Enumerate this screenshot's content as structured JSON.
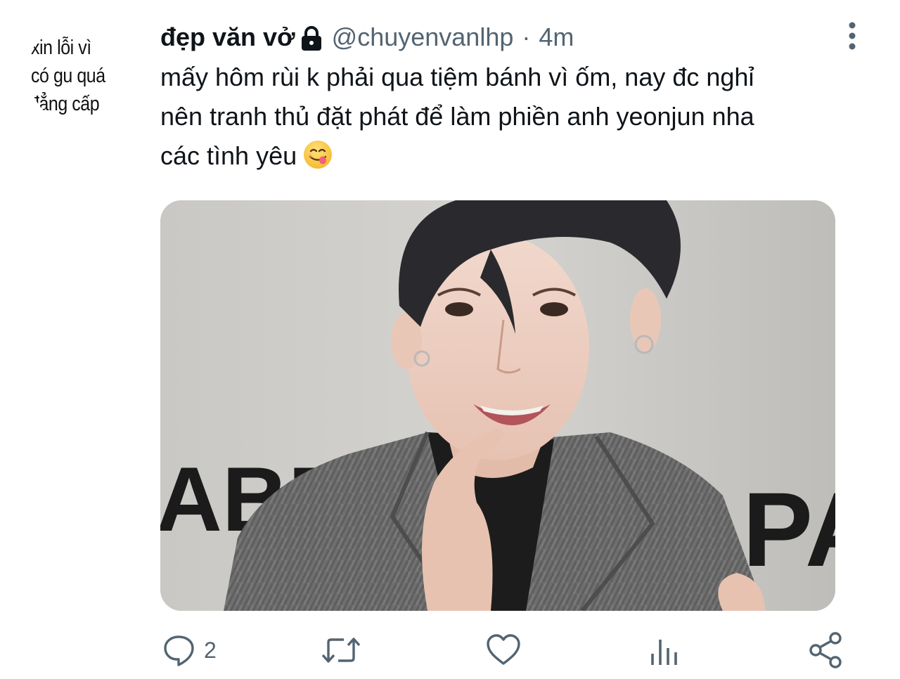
{
  "avatar": {
    "lines": [
      "xin  lỗi  vì",
      "có gu quá",
      "đẳng cấp"
    ]
  },
  "tweet": {
    "display_name": "đẹp văn vở",
    "handle": "@chuyenvanlhp",
    "separator": "·",
    "time": "4m",
    "text_lines": [
      "mấy hôm rùi k phải qua tiệm bánh vì ốm, nay đc nghỉ",
      "nên tranh thủ đặt phát để làm phiền anh yeonjun nha",
      "các tình yêu"
    ],
    "emoji": "face-savoring-food-icon",
    "media_backdrop_text_left": "ABEL",
    "media_backdrop_text_right": "PAI"
  },
  "actions": {
    "reply_count": "2",
    "icons": [
      "reply-icon",
      "retweet-icon",
      "like-icon",
      "views-icon",
      "share-icon"
    ]
  },
  "colors": {
    "text_primary": "#0f1419",
    "text_secondary": "#536471"
  }
}
